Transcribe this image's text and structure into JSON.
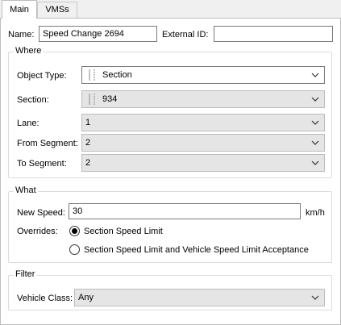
{
  "tabs": [
    {
      "label": "Main",
      "active": true
    },
    {
      "label": "VMSs",
      "active": false
    }
  ],
  "name": {
    "label": "Name:",
    "value": "Speed Change 2694"
  },
  "external_id": {
    "label": "External ID:",
    "value": ""
  },
  "where": {
    "title": "Where",
    "object_type": {
      "label": "Object Type:",
      "value": "Section"
    },
    "section": {
      "label": "Section:",
      "value": "934"
    },
    "lane": {
      "label": "Lane:",
      "value": "1"
    },
    "from_segment": {
      "label": "From Segment:",
      "value": "2"
    },
    "to_segment": {
      "label": "To Segment:",
      "value": "2"
    }
  },
  "what": {
    "title": "What",
    "new_speed": {
      "label": "New Speed:",
      "value": "30",
      "unit": "km/h"
    },
    "overrides": {
      "label": "Overrides:",
      "options": [
        {
          "label": "Section Speed Limit",
          "selected": true
        },
        {
          "label": "Section Speed Limit and Vehicle Speed Limit Acceptance",
          "selected": false
        }
      ]
    }
  },
  "filter": {
    "title": "Filter",
    "vehicle_class": {
      "label": "Vehicle Class:",
      "value": "Any"
    }
  }
}
